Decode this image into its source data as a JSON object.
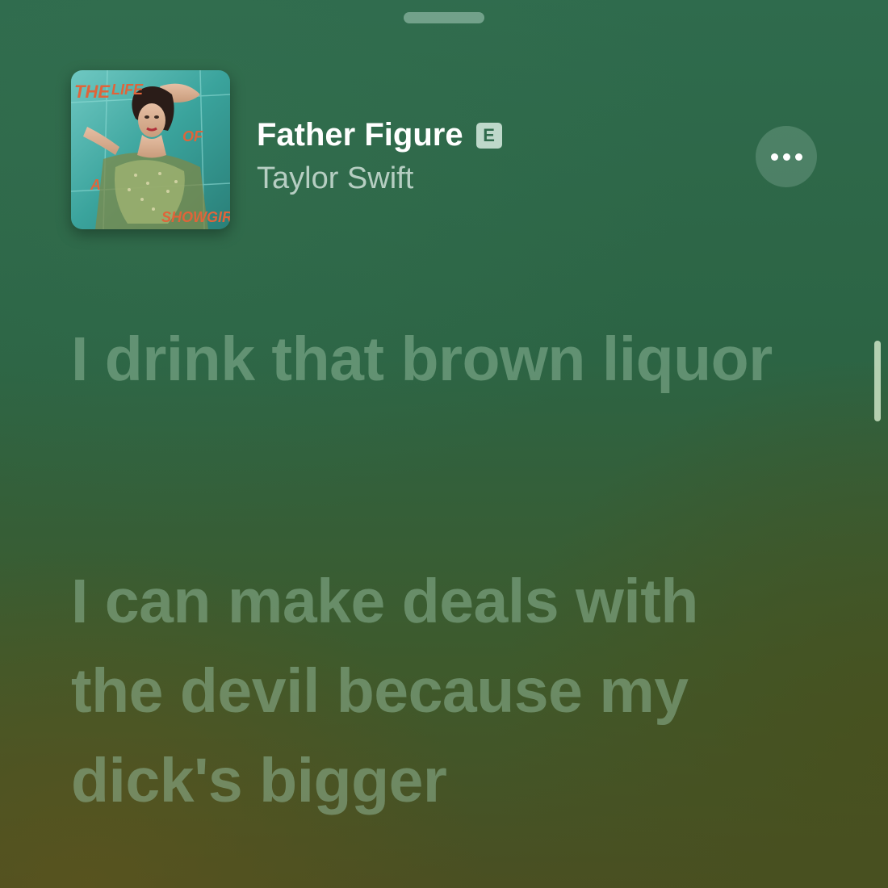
{
  "now_playing": {
    "title": "Father Figure",
    "explicit_badge": "E",
    "artist": "Taylor Swift"
  },
  "album_art": {
    "description": "album cover",
    "text_fragments": [
      "THE",
      "LIFE",
      "OF",
      "A",
      "SHOWGIRL"
    ]
  },
  "more_button": {
    "icon": "ellipsis-icon"
  },
  "lyrics": {
    "lines": [
      "I drink that brown liquor",
      "I can make deals with the devil because my dick's bigger"
    ]
  },
  "colors": {
    "background_top": "#2f6b4d",
    "background_bottom": "#4a4f22",
    "title_text": "#ffffff",
    "lyric_text_dim": "#96bea0"
  }
}
